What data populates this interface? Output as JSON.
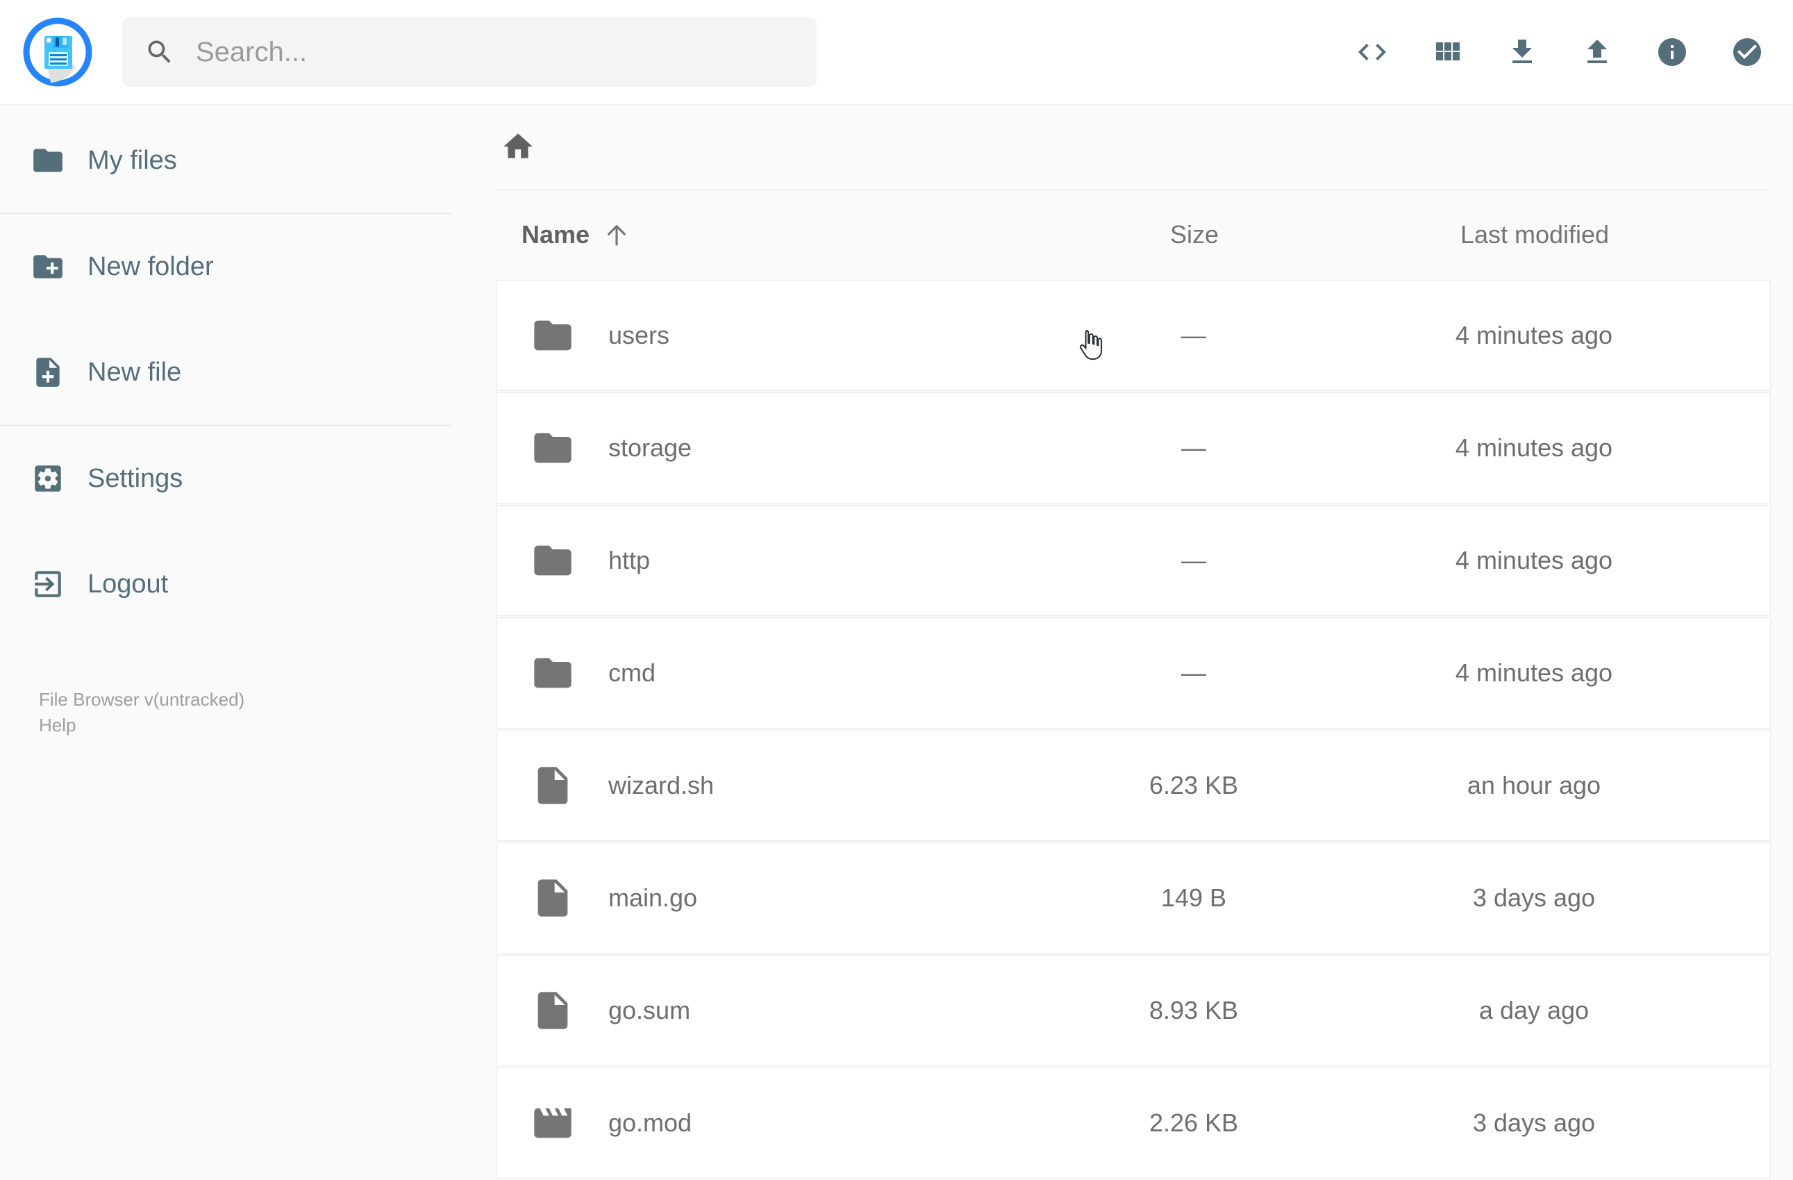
{
  "header": {
    "search": {
      "placeholder": "Search..."
    },
    "action_icons": [
      "code-icon",
      "grid-view-icon",
      "download-icon",
      "upload-icon",
      "info-icon",
      "select-multiple-icon"
    ]
  },
  "sidebar": {
    "items": [
      {
        "label": "My files",
        "icon": "folder-icon"
      },
      {
        "label": "New folder",
        "icon": "new-folder-icon"
      },
      {
        "label": "New file",
        "icon": "new-file-icon"
      },
      {
        "label": "Settings",
        "icon": "settings-icon"
      },
      {
        "label": "Logout",
        "icon": "logout-icon"
      }
    ],
    "footer": {
      "version": "File Browser v(untracked)",
      "help": "Help"
    }
  },
  "listing": {
    "columns": {
      "name": "Name",
      "size": "Size",
      "modified": "Last modified"
    },
    "sort": {
      "column": "Name",
      "direction": "ascending"
    },
    "rows": [
      {
        "name": "users",
        "type": "folder",
        "size": "—",
        "modified": "4 minutes ago"
      },
      {
        "name": "storage",
        "type": "folder",
        "size": "—",
        "modified": "4 minutes ago"
      },
      {
        "name": "http",
        "type": "folder",
        "size": "—",
        "modified": "4 minutes ago"
      },
      {
        "name": "cmd",
        "type": "folder",
        "size": "—",
        "modified": "4 minutes ago"
      },
      {
        "name": "wizard.sh",
        "type": "file",
        "size": "6.23 KB",
        "modified": "an hour ago"
      },
      {
        "name": "main.go",
        "type": "file",
        "size": "149 B",
        "modified": "3 days ago"
      },
      {
        "name": "go.sum",
        "type": "file",
        "size": "8.93 KB",
        "modified": "a day ago"
      },
      {
        "name": "go.mod",
        "type": "movie",
        "size": "2.26 KB",
        "modified": "3 days ago"
      }
    ]
  },
  "colors": {
    "accent_slate": "#546e7a",
    "logo_blue": "#2684ff",
    "logo_cyan": "#4fc3f7",
    "page_bg": "#fafafa",
    "row_bg": "#ffffff",
    "row_border": "#e9e9e9",
    "text_gray": "#6e6e6e",
    "icon_gray": "#757575"
  }
}
